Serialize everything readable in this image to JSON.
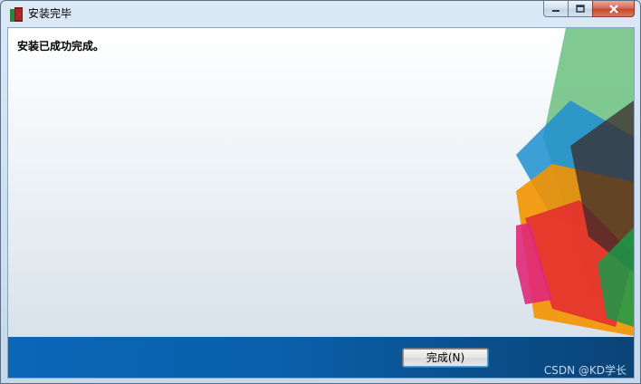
{
  "window": {
    "title": "安装完毕",
    "icon": "installer-icon",
    "controls": {
      "minimize": "minimize-icon",
      "maximize": "maximize-icon",
      "close": "close-icon"
    }
  },
  "content": {
    "message": "安装已成功完成。"
  },
  "footer": {
    "finish_label": "完成(N)",
    "watermark": "CSDN @KD学长"
  },
  "colors": {
    "bottom_bar": "#0a5fa9",
    "orange": "#f39200",
    "green": "#6abf7f",
    "red": "#e3302f",
    "magenta": "#e0287a",
    "blue": "#1f8fd0"
  }
}
